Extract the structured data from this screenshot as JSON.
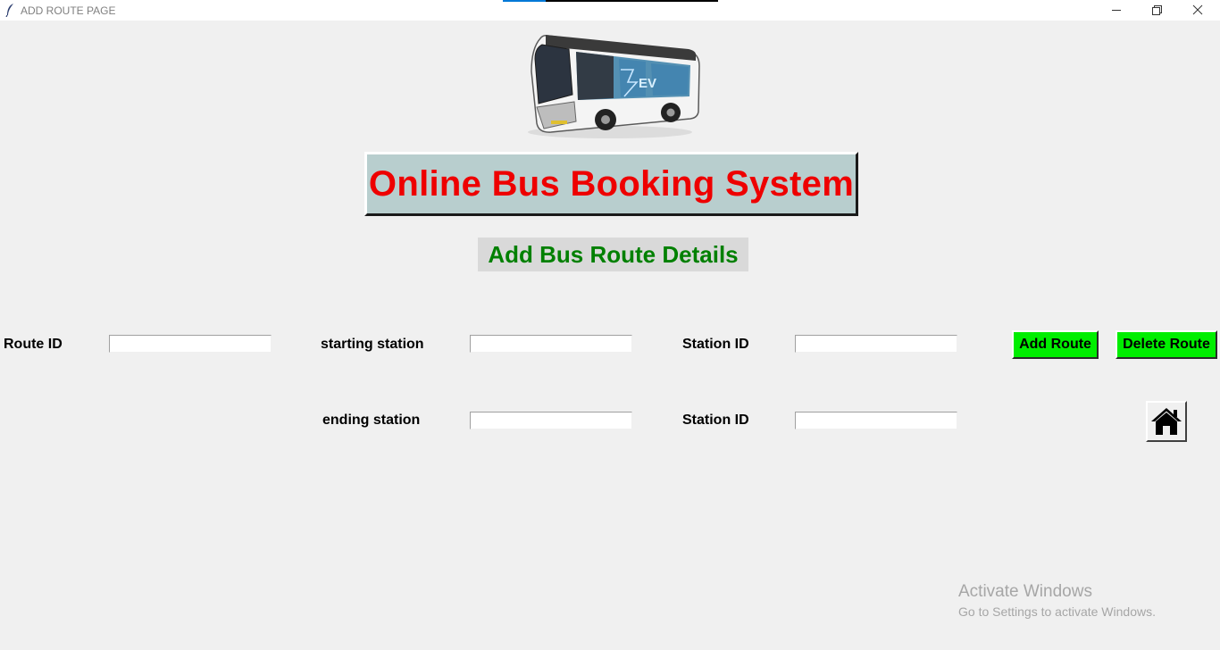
{
  "window": {
    "title": "ADD ROUTE PAGE",
    "icons": [
      "feather-icon",
      "minimize-icon",
      "maximize-icon",
      "close-icon"
    ]
  },
  "header": {
    "title": "Online Bus Booking System",
    "subtitle": "Add Bus Route Details",
    "title_color": "#ee0000",
    "subtitle_color": "#008000"
  },
  "form": {
    "route_id_label": "Route ID",
    "route_id_value": "",
    "starting_station_label": "starting station",
    "starting_station_value": "",
    "start_station_id_label": "Station ID",
    "start_station_id_value": "",
    "ending_station_label": "ending station",
    "ending_station_value": "",
    "end_station_id_label": "Station ID",
    "end_station_id_value": ""
  },
  "buttons": {
    "add_route": "Add Route",
    "delete_route": "Delete Route",
    "home_icon": "home-icon",
    "accent": "#00ee00"
  },
  "watermark": {
    "line1": "Activate Windows",
    "line2": "Go to Settings to activate Windows."
  }
}
